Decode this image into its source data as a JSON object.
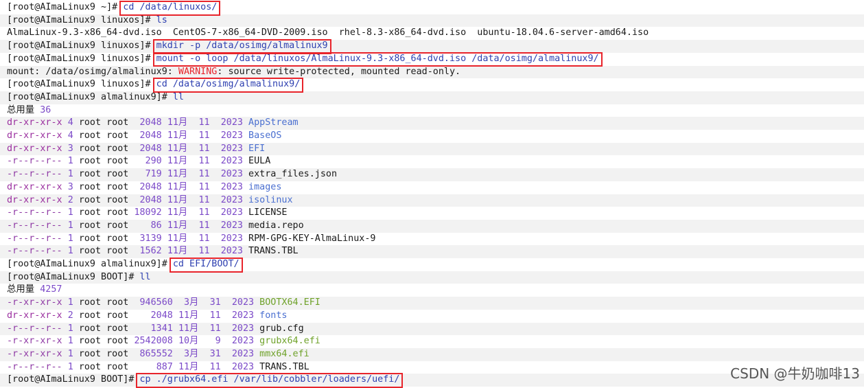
{
  "terminal": {
    "lines": [
      {
        "prompt": "[root@AImaLinux9 ~]# ",
        "cmd": "cd /data/linuxos/",
        "boxed": true
      },
      {
        "prompt": "[root@AImaLinux9 linuxos]# ",
        "cmd": "ls"
      },
      {
        "text": "AlmaLinux-9.3-x86_64-dvd.iso  CentOS-7-x86_64-DVD-2009.iso  rhel-8.3-x86_64-dvd.iso  ubuntu-18.04.6-server-amd64.iso"
      },
      {
        "prompt": "[root@AImaLinux9 linuxos]# ",
        "cmd": "mkdir -p /data/osimg/almalinux9",
        "boxed": true
      },
      {
        "prompt": "[root@AImaLinux9 linuxos]# ",
        "cmd": "mount -o loop /data/linuxos/AlmaLinux-9.3-x86_64-dvd.iso /data/osimg/almalinux9/",
        "boxed": true
      },
      {
        "mount_msg": true
      },
      {
        "prompt": "[root@AImaLinux9 linuxos]# ",
        "cmd": "cd /data/osimg/almalinux9/",
        "boxed": true
      },
      {
        "prompt": "[root@AImaLinux9 almalinux9]# ",
        "cmd": "ll"
      },
      {
        "total_label": "总用量 ",
        "total_value": "36"
      },
      {
        "ls": {
          "perm": "dr-xr-xr-x",
          "links": "4",
          "owner": "root",
          "group": "root",
          "size": "2048",
          "month": "11月",
          "day": "11",
          "year": "2023",
          "name": "AppStream",
          "kind": "dir"
        }
      },
      {
        "ls": {
          "perm": "dr-xr-xr-x",
          "links": "4",
          "owner": "root",
          "group": "root",
          "size": "2048",
          "month": "11月",
          "day": "11",
          "year": "2023",
          "name": "BaseOS",
          "kind": "dir"
        }
      },
      {
        "ls": {
          "perm": "dr-xr-xr-x",
          "links": "3",
          "owner": "root",
          "group": "root",
          "size": "2048",
          "month": "11月",
          "day": "11",
          "year": "2023",
          "name": "EFI",
          "kind": "dir"
        }
      },
      {
        "ls": {
          "perm": "-r--r--r--",
          "links": "1",
          "owner": "root",
          "group": "root",
          "size": "290",
          "month": "11月",
          "day": "11",
          "year": "2023",
          "name": "EULA",
          "kind": "file"
        }
      },
      {
        "ls": {
          "perm": "-r--r--r--",
          "links": "1",
          "owner": "root",
          "group": "root",
          "size": "719",
          "month": "11月",
          "day": "11",
          "year": "2023",
          "name": "extra_files.json",
          "kind": "file"
        }
      },
      {
        "ls": {
          "perm": "dr-xr-xr-x",
          "links": "3",
          "owner": "root",
          "group": "root",
          "size": "2048",
          "month": "11月",
          "day": "11",
          "year": "2023",
          "name": "images",
          "kind": "dir"
        }
      },
      {
        "ls": {
          "perm": "dr-xr-xr-x",
          "links": "2",
          "owner": "root",
          "group": "root",
          "size": "2048",
          "month": "11月",
          "day": "11",
          "year": "2023",
          "name": "isolinux",
          "kind": "dir"
        }
      },
      {
        "ls": {
          "perm": "-r--r--r--",
          "links": "1",
          "owner": "root",
          "group": "root",
          "size": "18092",
          "month": "11月",
          "day": "11",
          "year": "2023",
          "name": "LICENSE",
          "kind": "file"
        }
      },
      {
        "ls": {
          "perm": "-r--r--r--",
          "links": "1",
          "owner": "root",
          "group": "root",
          "size": "86",
          "month": "11月",
          "day": "11",
          "year": "2023",
          "name": "media.repo",
          "kind": "file"
        }
      },
      {
        "ls": {
          "perm": "-r--r--r--",
          "links": "1",
          "owner": "root",
          "group": "root",
          "size": "3139",
          "month": "11月",
          "day": "11",
          "year": "2023",
          "name": "RPM-GPG-KEY-AlmaLinux-9",
          "kind": "file"
        }
      },
      {
        "ls": {
          "perm": "-r--r--r--",
          "links": "1",
          "owner": "root",
          "group": "root",
          "size": "1562",
          "month": "11月",
          "day": "11",
          "year": "2023",
          "name": "TRANS.TBL",
          "kind": "file"
        }
      },
      {
        "prompt": "[root@AImaLinux9 almalinux9]# ",
        "cmd": "cd EFI/BOOT/",
        "boxed": true
      },
      {
        "prompt": "[root@AImaLinux9 BOOT]# ",
        "cmd": "ll"
      },
      {
        "total_label": "总用量 ",
        "total_value": "4257"
      },
      {
        "ls": {
          "perm": "-r-xr-xr-x",
          "links": "1",
          "owner": "root",
          "group": "root",
          "size": "946560",
          "month": "3月",
          "day": "31",
          "year": "2023",
          "name": "BOOTX64.EFI",
          "kind": "exec"
        }
      },
      {
        "ls": {
          "perm": "dr-xr-xr-x",
          "links": "2",
          "owner": "root",
          "group": "root",
          "size": "2048",
          "month": "11月",
          "day": "11",
          "year": "2023",
          "name": "fonts",
          "kind": "dir"
        }
      },
      {
        "ls": {
          "perm": "-r--r--r--",
          "links": "1",
          "owner": "root",
          "group": "root",
          "size": "1341",
          "month": "11月",
          "day": "11",
          "year": "2023",
          "name": "grub.cfg",
          "kind": "file"
        }
      },
      {
        "ls": {
          "perm": "-r-xr-xr-x",
          "links": "1",
          "owner": "root",
          "group": "root",
          "size": "2542008",
          "month": "10月",
          "day": "9",
          "year": "2023",
          "name": "grubx64.efi",
          "kind": "exec"
        }
      },
      {
        "ls": {
          "perm": "-r-xr-xr-x",
          "links": "1",
          "owner": "root",
          "group": "root",
          "size": "865552",
          "month": "3月",
          "day": "31",
          "year": "2023",
          "name": "mmx64.efi",
          "kind": "exec"
        }
      },
      {
        "ls": {
          "perm": "-r--r--r--",
          "links": "1",
          "owner": "root",
          "group": "root",
          "size": "887",
          "month": "11月",
          "day": "11",
          "year": "2023",
          "name": "TRANS.TBL",
          "kind": "file"
        }
      },
      {
        "prompt": "[root@AImaLinux9 BOOT]# ",
        "cmd": "cp ./grubx64.efi /var/lib/cobbler/loaders/uefi/",
        "boxed": true
      }
    ],
    "mount_message": {
      "prefix": "mount: /data/osimg/almalinux9: ",
      "warning": "WARNING",
      "suffix": ": source write-protected, mounted read-only."
    }
  },
  "watermark": "CSDN @牛奶咖啡13",
  "colors": {
    "highlight_box": "#e8242b",
    "band": "#f2f2f2",
    "dir": "#4a6fd0",
    "exec": "#6fa22a",
    "number": "#7b49c8",
    "perm": "#9a2f9f"
  }
}
